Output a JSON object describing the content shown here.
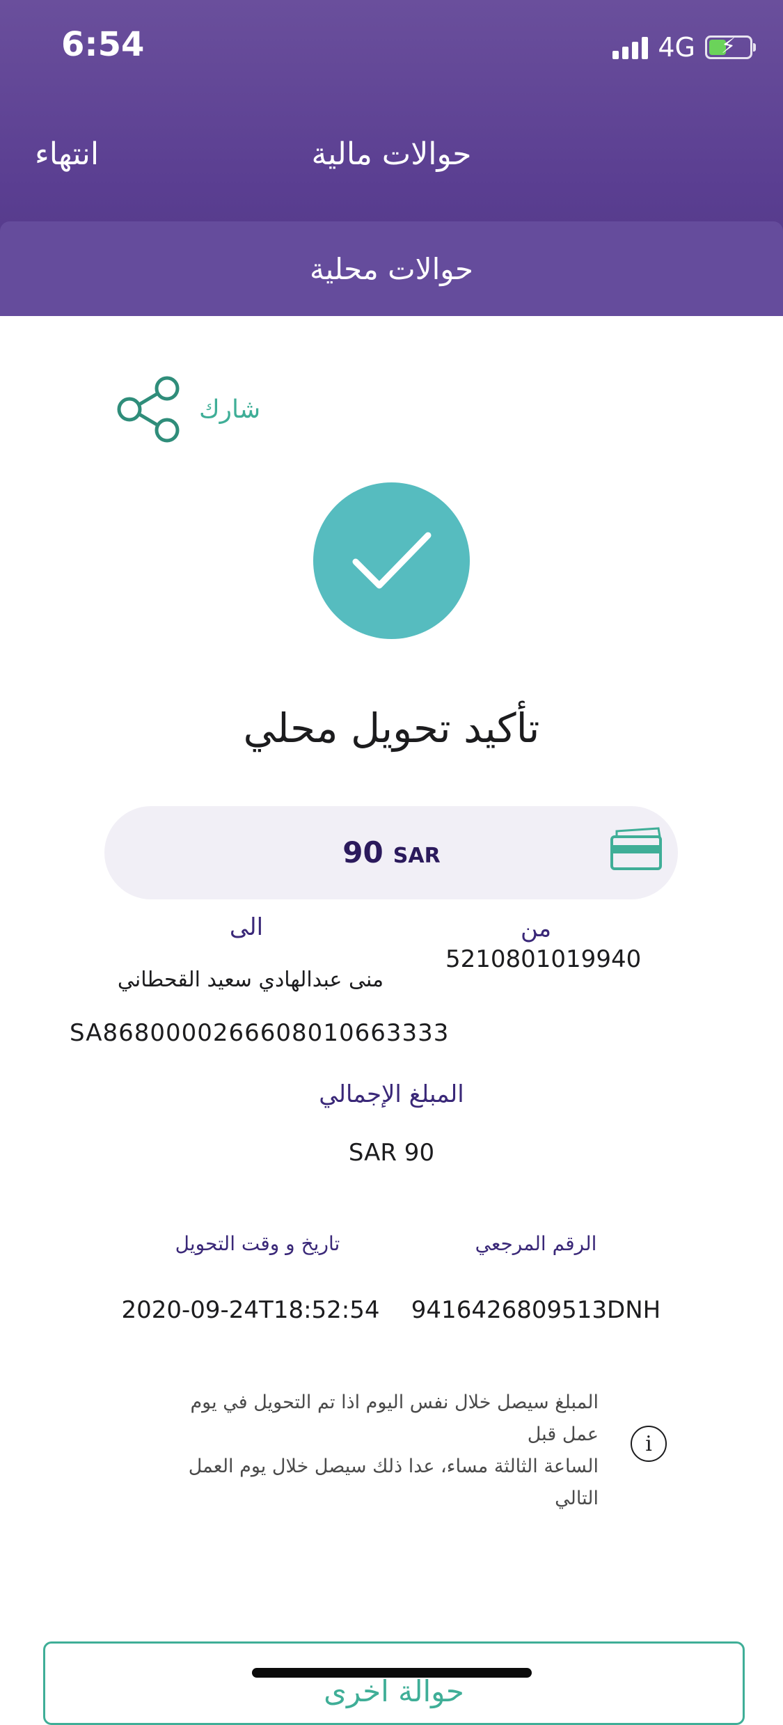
{
  "status_bar": {
    "time": "6:54",
    "network": "4G"
  },
  "header": {
    "done_label": "انتهاء",
    "title": "حوالات مالية"
  },
  "tab": {
    "label": "حوالات محلية"
  },
  "share": {
    "label": "شارك"
  },
  "confirmation": {
    "title": "تأكيد تحويل محلي"
  },
  "amount": {
    "value": "90",
    "currency": "SAR"
  },
  "transfer": {
    "to_label": "الى",
    "from_label": "من",
    "from_account": "5210801019940",
    "recipient_name": "منى عبدالهادي سعيد القحطاني",
    "recipient_iban": "SA8680000266608010663333"
  },
  "total": {
    "label": "المبلغ الإجمالي",
    "value": "SAR 90"
  },
  "details": {
    "datetime_label": "تاريخ و وقت التحويل",
    "datetime_value": "2020-09-24T18:52:54",
    "reference_label": "الرقم المرجعي",
    "reference_value": "9416426809513DNH"
  },
  "notice": {
    "line1": "المبلغ سيصل خلال نفس اليوم اذا تم التحويل في يوم عمل قبل",
    "line2": "الساعة الثالثة مساء، عدا ذلك سيصل خلال يوم العمل التالي"
  },
  "actions": {
    "another_transfer_label": "حوالة اخرى"
  },
  "colors": {
    "header": "#5a3e91",
    "tab": "#654c9c",
    "accent": "#3fae97",
    "success": "#56bcbf"
  }
}
